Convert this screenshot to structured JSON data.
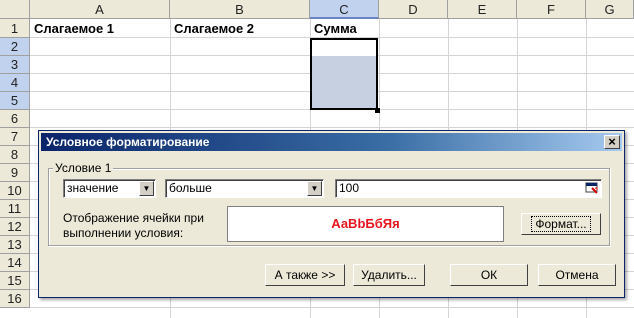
{
  "spreadsheet": {
    "columns": [
      "A",
      "B",
      "C",
      "D",
      "E",
      "F",
      "G"
    ],
    "selected_column": "C",
    "rows": [
      "1",
      "2",
      "3",
      "4",
      "5",
      "6",
      "7",
      "8",
      "9",
      "10",
      "11",
      "12",
      "13",
      "14",
      "15",
      "16"
    ],
    "selected_rows": [
      "2",
      "3",
      "4",
      "5"
    ],
    "cells": {
      "a1": "Слагаемое 1",
      "b1": "Слагаемое 2",
      "c1": "Сумма"
    }
  },
  "dialog": {
    "title": "Условное форматирование",
    "close_glyph": "×",
    "condition_group_label": "Условие 1",
    "condition_type": "значение",
    "operator": "больше",
    "value": "100",
    "preview_caption": "Отображение ячейки при выполнении условия:",
    "preview_text": "АаBbБбЯя",
    "preview_color": "#e8141e",
    "format_button": "Формат...",
    "also_button": "А также >>",
    "delete_button": "Удалить...",
    "ok_button": "ОК",
    "cancel_button": "Отмена"
  }
}
